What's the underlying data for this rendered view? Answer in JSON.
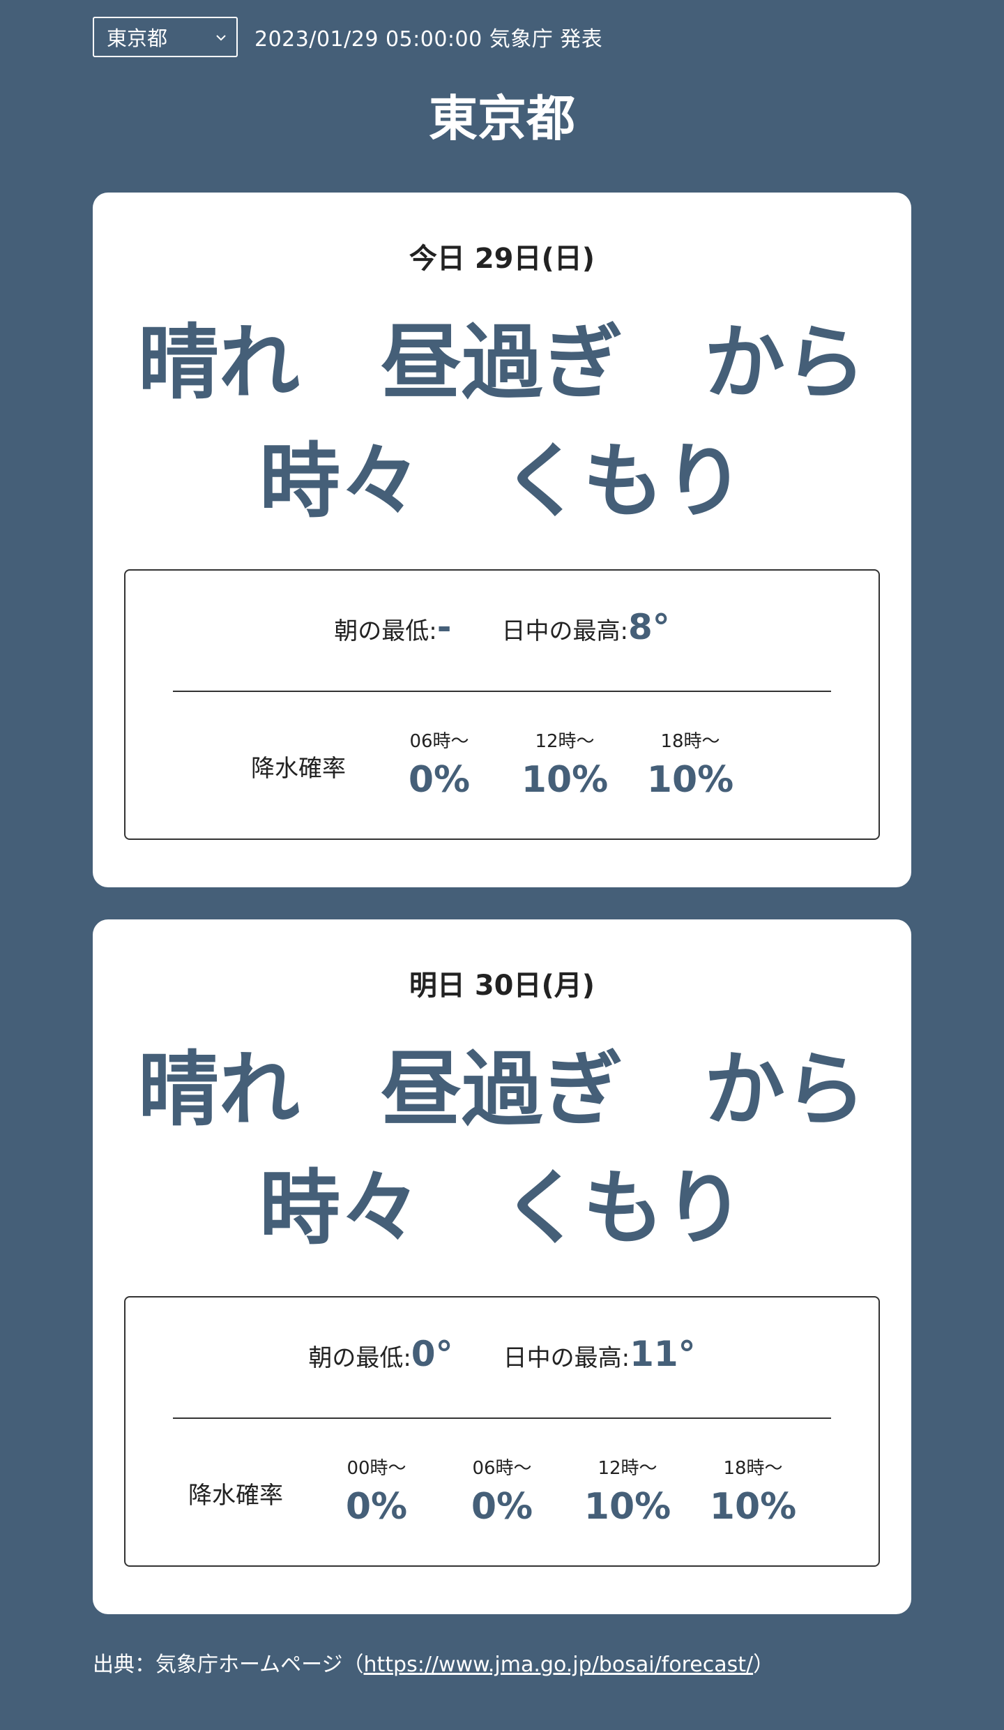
{
  "header": {
    "select_value": "東京都",
    "issued_text": "2023/01/29 05:00:00 気象庁 発表",
    "page_title": "東京都"
  },
  "forecasts": [
    {
      "date": "今日 29日(日)",
      "weather": "晴れ　昼過ぎ　から\n時々　くもり",
      "min_label": "朝の最低:",
      "min_value": "-",
      "max_label": "日中の最高:",
      "max_value": "8°",
      "precip_label": "降水確率",
      "slots": [
        {
          "time": "06時～",
          "value": "0%"
        },
        {
          "time": "12時～",
          "value": "10%"
        },
        {
          "time": "18時～",
          "value": "10%"
        }
      ]
    },
    {
      "date": "明日 30日(月)",
      "weather": "晴れ　昼過ぎ　から\n時々　くもり",
      "min_label": "朝の最低:",
      "min_value": "0°",
      "max_label": "日中の最高:",
      "max_value": "11°",
      "precip_label": "降水確率",
      "slots": [
        {
          "time": "00時～",
          "value": "0%"
        },
        {
          "time": "06時～",
          "value": "0%"
        },
        {
          "time": "12時～",
          "value": "10%"
        },
        {
          "time": "18時～",
          "value": "10%"
        }
      ]
    }
  ],
  "footer": {
    "prefix": "出典：気象庁ホームページ（",
    "link_text": "https://www.jma.go.jp/bosai/forecast/",
    "suffix": "）"
  },
  "colors": {
    "background": "#455f78",
    "accent": "#455f78",
    "card": "#ffffff"
  },
  "icons": {
    "select_arrow": "chevron-down-icon"
  }
}
